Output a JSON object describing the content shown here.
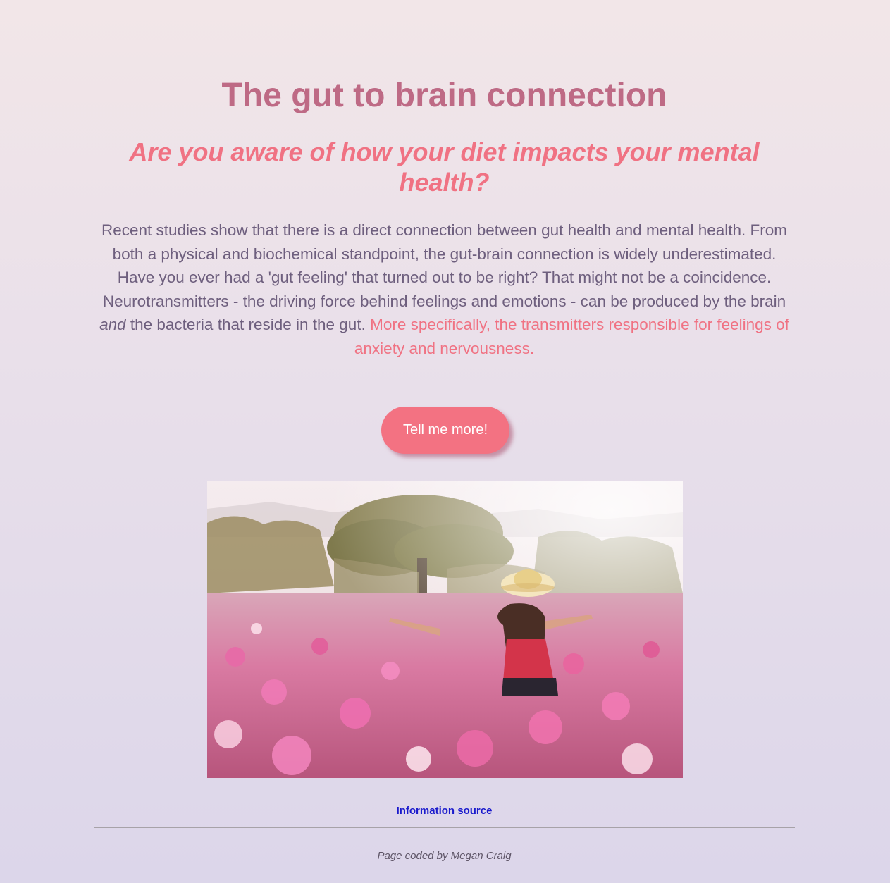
{
  "header": {
    "title": "The gut to brain connection",
    "subtitle": "Are you aware of how your diet impacts your mental health?"
  },
  "intro": {
    "line1": "Recent studies show that there is a direct connection between gut health and mental health. From both a physical and biochemical standpoint, the gut-brain connection is widely underestimated.",
    "line2_start": "Have you ever had a 'gut feeling' that turned out to be right? That might not be a coincidence. Neurotransmitters - the driving force behind feelings and emotions - can be produced by the brain ",
    "line2_emphasis": "and",
    "line2_end": " the bacteria that reside in the gut. ",
    "highlight": "More specifically, the transmitters responsible for feelings of anxiety and nervousness."
  },
  "cta": {
    "label": "Tell me more!"
  },
  "links": {
    "source_label": "Information source"
  },
  "footer": {
    "credit": "Page coded by Megan Craig"
  },
  "colors": {
    "title": "#be6a85",
    "accent": "#f07283",
    "body_text": "#6e5f7e",
    "button": "#f37282",
    "link": "#1a1acc"
  }
}
